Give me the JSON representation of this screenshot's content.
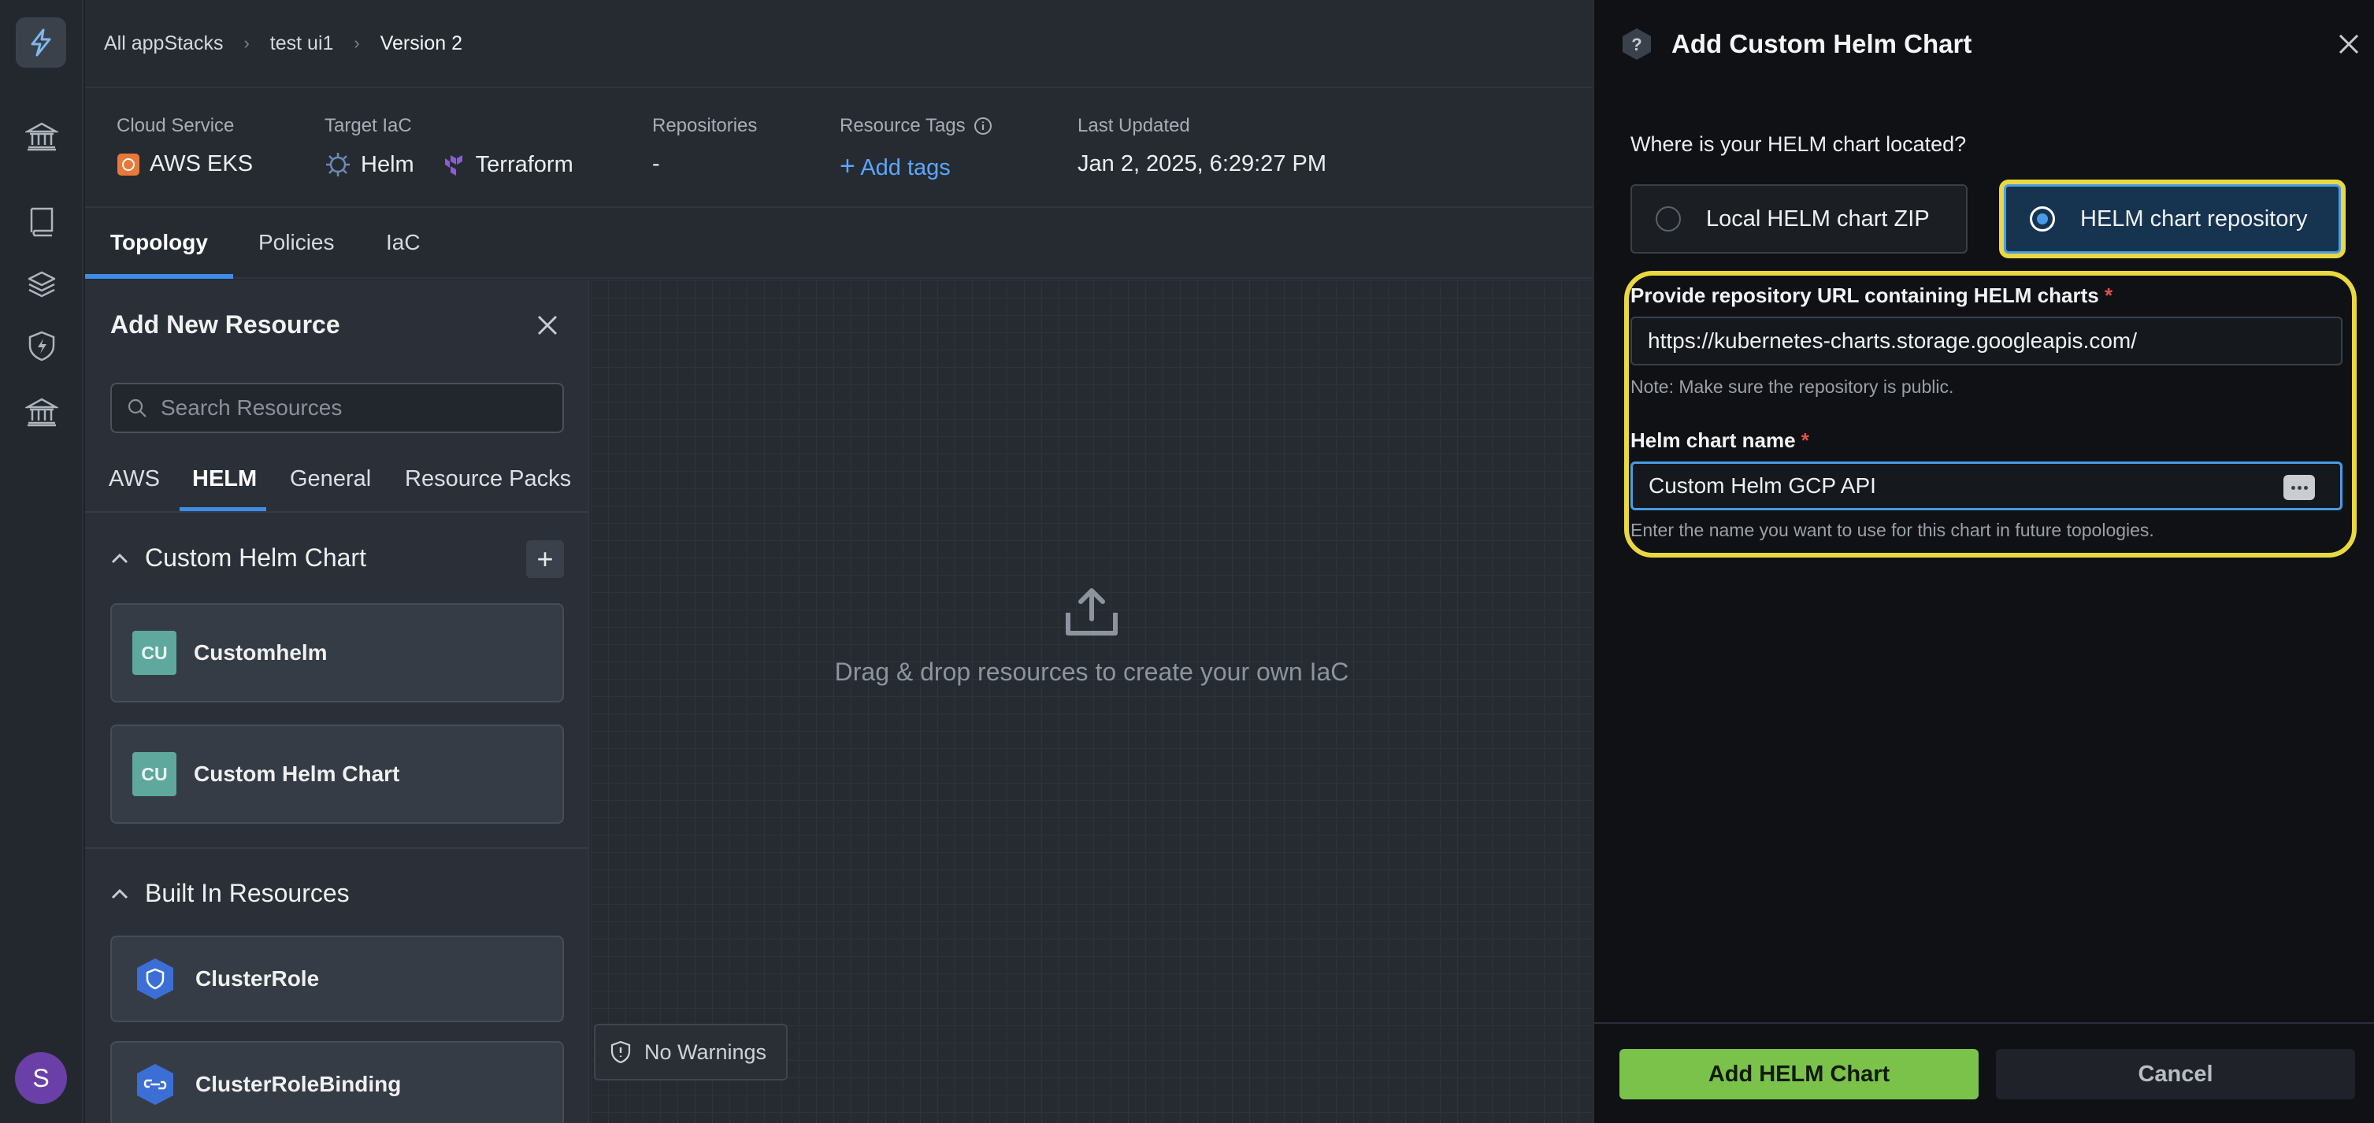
{
  "breadcrumb": [
    "All appStacks",
    "test ui1",
    "Version 2"
  ],
  "info": {
    "cloud_service": {
      "label": "Cloud Service",
      "value": "AWS EKS"
    },
    "target_iac": {
      "label": "Target IaC",
      "values": [
        "Helm",
        "Terraform"
      ]
    },
    "repositories": {
      "label": "Repositories",
      "value": "-"
    },
    "resource_tags": {
      "label": "Resource Tags",
      "action": "Add tags"
    },
    "last_updated": {
      "label": "Last Updated",
      "value": "Jan 2, 2025, 6:29:27 PM"
    }
  },
  "tabs": [
    "Topology",
    "Policies",
    "IaC"
  ],
  "resource_panel": {
    "title": "Add New Resource",
    "search_placeholder": "Search Resources",
    "tabs": [
      "AWS",
      "HELM",
      "General",
      "Resource Packs"
    ],
    "custom_section": "Custom Helm Chart",
    "custom_items": [
      {
        "badge": "CU",
        "label": "Customhelm"
      },
      {
        "badge": "CU",
        "label": "Custom Helm Chart"
      }
    ],
    "builtin_section": "Built In Resources",
    "builtin_items": [
      "ClusterRole",
      "ClusterRoleBinding"
    ]
  },
  "canvas": {
    "drop_text": "Drag & drop resources to create your own IaC",
    "warnings": "No Warnings"
  },
  "drawer": {
    "title": "Add Custom Helm Chart",
    "question": "Where is your HELM chart located?",
    "option_local": "Local HELM chart ZIP",
    "option_repo": "HELM chart repository",
    "repo_url_label": "Provide repository URL containing HELM charts",
    "repo_url_value": "https://kubernetes-charts.storage.googleapis.com/",
    "repo_note": "Note: Make sure the repository is public.",
    "chart_name_label": "Helm chart name",
    "chart_name_value": "Custom Helm GCP API",
    "chart_name_hint": "Enter the name you want to use for this chart in future topologies.",
    "required_mark": "*",
    "add_button": "Add HELM Chart",
    "cancel_button": "Cancel"
  },
  "user": {
    "avatar_initial": "S"
  },
  "colors": {
    "accent": "#3e8de8",
    "primary_button": "#7bc24a",
    "highlight": "#e9d83f"
  }
}
